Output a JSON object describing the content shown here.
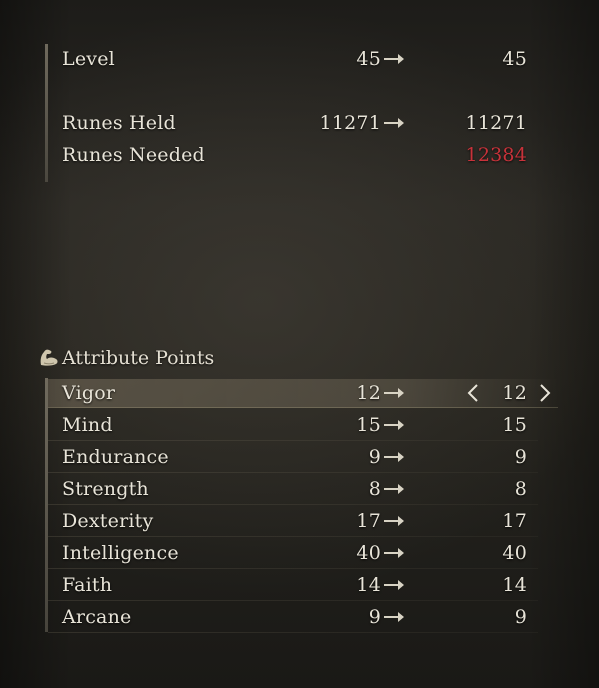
{
  "summary": {
    "level": {
      "label": "Level",
      "current": "45",
      "next": "45"
    },
    "runes_held": {
      "label": "Runes Held",
      "current": "11271",
      "next": "11271"
    },
    "runes_needed": {
      "label": "Runes Needed",
      "next": "12384"
    }
  },
  "attributes": {
    "title": "Attribute Points",
    "items": [
      {
        "label": "Vigor",
        "current": "12",
        "next": "12"
      },
      {
        "label": "Mind",
        "current": "15",
        "next": "15"
      },
      {
        "label": "Endurance",
        "current": "9",
        "next": "9"
      },
      {
        "label": "Strength",
        "current": "8",
        "next": "8"
      },
      {
        "label": "Dexterity",
        "current": "17",
        "next": "17"
      },
      {
        "label": "Intelligence",
        "current": "40",
        "next": "40"
      },
      {
        "label": "Faith",
        "current": "14",
        "next": "14"
      },
      {
        "label": "Arcane",
        "current": "9",
        "next": "9"
      }
    ]
  },
  "colors": {
    "text": "#e8e4d8",
    "needed_runes": "#c8323a",
    "arrow": "#d8d3c4"
  },
  "icons": {
    "section": "flexed-arm-icon",
    "arrow": "right-arrow-icon",
    "decrease": "chevron-left-icon",
    "increase": "chevron-right-icon"
  }
}
